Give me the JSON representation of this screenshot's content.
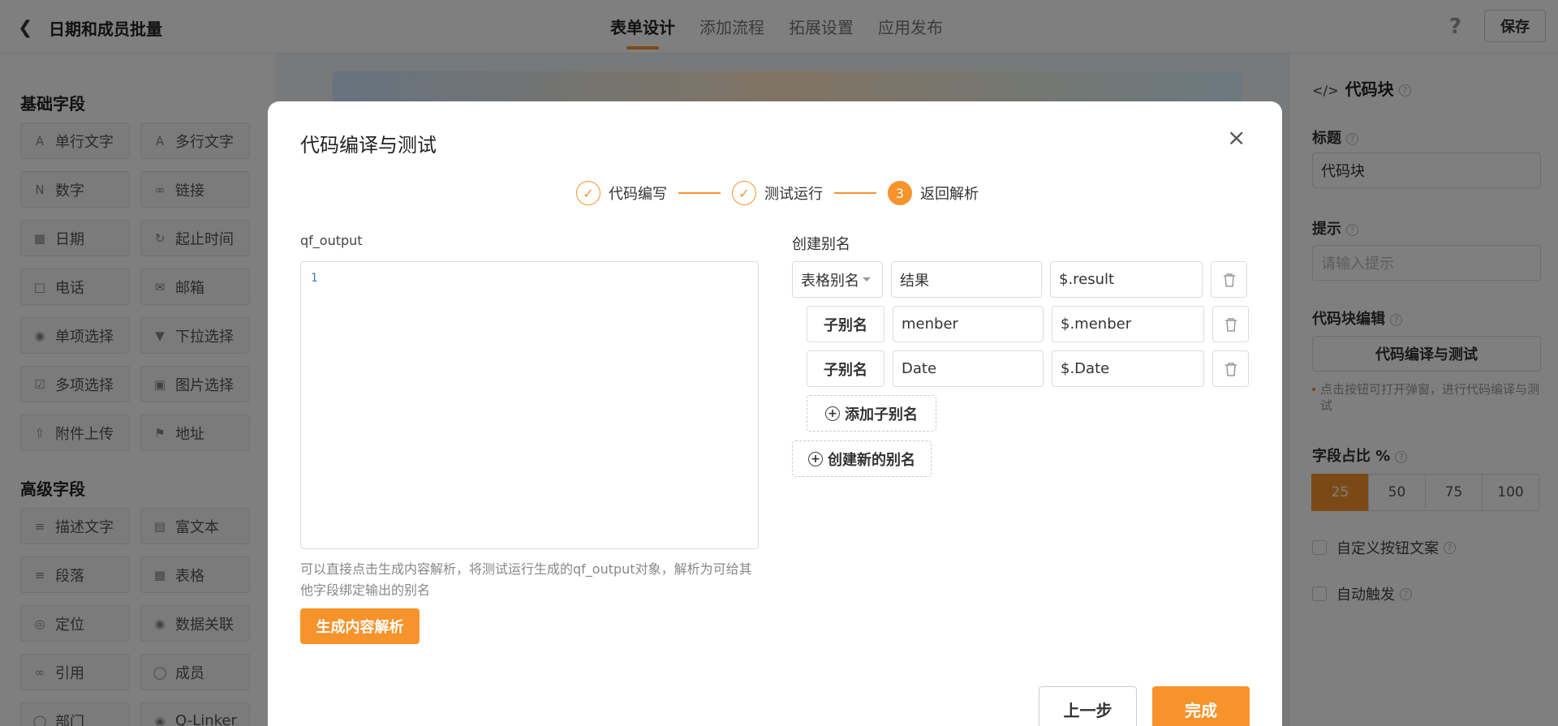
{
  "header": {
    "title": "日期和成员批量",
    "tabs": [
      "表单设计",
      "添加流程",
      "拓展设置",
      "应用发布"
    ],
    "help_glyph": "?",
    "save_label": "保存"
  },
  "left_panel": {
    "basic_title": "基础字段",
    "basic_fields": [
      {
        "label": "单行文字",
        "icon": "text-line-icon"
      },
      {
        "label": "多行文字",
        "icon": "text-multiline-icon"
      },
      {
        "label": "数字",
        "icon": "number-icon"
      },
      {
        "label": "链接",
        "icon": "link-icon"
      },
      {
        "label": "日期",
        "icon": "calendar-icon"
      },
      {
        "label": "起止时间",
        "icon": "time-range-icon"
      },
      {
        "label": "电话",
        "icon": "phone-icon"
      },
      {
        "label": "邮箱",
        "icon": "mail-icon"
      },
      {
        "label": "单项选择",
        "icon": "radio-icon"
      },
      {
        "label": "下拉选择",
        "icon": "dropdown-icon"
      },
      {
        "label": "多项选择",
        "icon": "checkbox-icon"
      },
      {
        "label": "图片选择",
        "icon": "image-icon"
      },
      {
        "label": "附件上传",
        "icon": "upload-icon"
      },
      {
        "label": "地址",
        "icon": "address-icon"
      }
    ],
    "advanced_title": "高级字段",
    "advanced_fields": [
      {
        "label": "描述文字",
        "icon": "description-icon"
      },
      {
        "label": "富文本",
        "icon": "rich-text-icon"
      },
      {
        "label": "段落",
        "icon": "paragraph-icon"
      },
      {
        "label": "表格",
        "icon": "table-icon"
      },
      {
        "label": "定位",
        "icon": "location-icon"
      },
      {
        "label": "数据关联",
        "icon": "data-link-icon"
      },
      {
        "label": "引用",
        "icon": "reference-icon"
      },
      {
        "label": "成员",
        "icon": "member-icon"
      },
      {
        "label": "部门",
        "icon": "department-icon"
      },
      {
        "label": "Q-Linker",
        "icon": "qlinker-icon"
      }
    ]
  },
  "right_panel": {
    "title": "代码块",
    "title_label": "标题",
    "title_value": "代码块",
    "hint_label": "提示",
    "hint_placeholder": "请输入提示",
    "editor_label": "代码块编辑",
    "editor_button": "代码编译与测试",
    "editor_note": "点击按钮可打开弹窗，进行代码编译与测试",
    "ratio_label": "字段占比 %",
    "ratio_options": [
      "25",
      "50",
      "75",
      "100"
    ],
    "ratio_selected": "25",
    "custom_button_text": "自定义按钮文案",
    "auto_trigger": "自动触发"
  },
  "modal": {
    "title": "代码编译与测试",
    "close_glyph": "×",
    "steps": [
      {
        "label": "代码编写",
        "status": "done"
      },
      {
        "label": "测试运行",
        "status": "done"
      },
      {
        "label": "返回解析",
        "status": "current",
        "number": "3"
      }
    ],
    "output_label": "qf_output",
    "editor_line": "1",
    "hint": "可以直接点击生成内容解析，将测试运行生成的qf_output对象，解析为可给其他字段绑定输出的别名",
    "generate_button": "生成内容解析",
    "alias_title": "创建别名",
    "alias_rows": [
      {
        "type": "表格别名",
        "name": "结果",
        "path": "$.result"
      },
      {
        "type": "子别名",
        "name": "menber",
        "path": "$.menber"
      },
      {
        "type": "子别名",
        "name": "Date",
        "path": "$.Date"
      }
    ],
    "add_sub_alias": "添加子别名",
    "create_alias": "创建新的别名",
    "prev_button": "上一步",
    "done_button": "完成"
  },
  "colors": {
    "accent": "#f7932b",
    "overlay": "rgba(0,0,0,0.5)"
  }
}
